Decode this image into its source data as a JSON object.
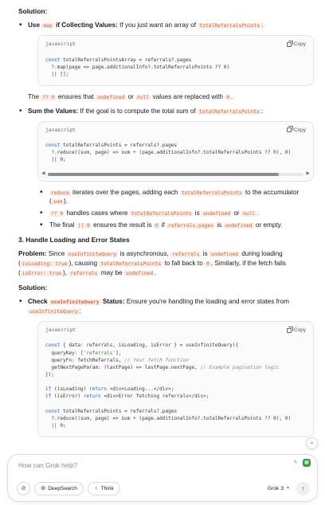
{
  "solution1": {
    "heading": "Solution:",
    "item1": {
      "lead": "Use",
      "map": "map",
      "lead2": "if Collecting Values:",
      "text": "If you just want an array of",
      "code": "totalReferralsPoints",
      "end": ":"
    },
    "code1": {
      "lang": "javascript",
      "copy": "Copy",
      "l1a": "const",
      "l1b": " totalReferralsPointsArray = referrals?.pages",
      "l2": "  ?.map(page => page.additionalInfo?.totalReferralsPoints ?? 0)",
      "l3": "  || [];"
    },
    "note": {
      "t1": "The",
      "c1": "?? 0",
      "t2": "ensures that",
      "c2": "undefined",
      "t3": "or",
      "c3": "null",
      "t4": "values are replaced with",
      "c4": "0",
      "t5": "."
    },
    "item2": {
      "lead": "Sum the Values:",
      "text": "If the goal is to compute the total sum of",
      "code": "totalReferralsPoints",
      "end": ":"
    },
    "code2": {
      "lang": "javascript",
      "copy": "Copy",
      "l1a": "const",
      "l1b": " totalReferralsPoints = referrals?.pages",
      "l2": "  ?.reduce((sum, page) => sum + (page.additionalInfo?.totalReferralsPoints ?? 0), 0)",
      "l3": "  || 0;"
    },
    "sub": [
      {
        "c1": "reduce",
        "t1": "iterates over the pages, adding each",
        "c2": "totalReferralsPoints",
        "t2": "to the accumulator",
        "c3": "sum",
        "t3": ").",
        "open": "("
      },
      {
        "c1": "?? 0",
        "t1": "handles cases where",
        "c2": "totalReferralsPoints",
        "t2": "is",
        "c3": "undefined",
        "t3": "or",
        "c4": "null",
        "t4": "."
      },
      {
        "t0": "The final",
        "c1": "|| 0",
        "t1": "ensures the result is",
        "c2": "0",
        "t2": "if",
        "c3": "referrals.pages",
        "t3": "is",
        "c4": "undefined",
        "t4": "or empty."
      }
    ]
  },
  "section3": {
    "title": "3. Handle Loading and Error States",
    "problem": {
      "lead": "Problem:",
      "t1": "Since",
      "c1": "useInfiniteQuery",
      "t2": "is asynchronous,",
      "c2": "referrals",
      "t3": "is",
      "c3": "undefined",
      "t4": "during loading",
      "open": "(",
      "c4": "isLoading: true",
      "t5": "), causing",
      "c5": "totalReferralsPoints",
      "t6": "to fall back to",
      "c6": "0",
      "t7": ". Similarly, if the fetch fails",
      "c7": "isError: true",
      "t8": "),",
      "c8": "referrals",
      "t9": "may be",
      "c9": "undefined",
      "t10": "."
    },
    "heading": "Solution:",
    "item": {
      "lead": "Check",
      "code": "useInfiniteQuery",
      "lead2": "Status:",
      "text": "Ensure you're handling the loading and error states from",
      "code2": "useInfiniteQuery",
      "end": ":"
    },
    "code3": {
      "lang": "javascript",
      "copy": "Copy",
      "l1a": "const",
      "l1b": " { data: referrals, isLoading, isError } = useInfiniteQuery({",
      "l2a": "  queryKey: [",
      "l2b": "'referrals'",
      "l2c": "],",
      "l3a": "  queryFn: fetchReferrals, ",
      "l3b": "// Your fetch function",
      "l4a": "  getNextPageParam: (lastPage) => lastPage.nextPage, ",
      "l4b": "// Example pagination logic",
      "l5": "});",
      "l6a": "if",
      "l6b": " (isLoading) ",
      "l6c": "return",
      "l6d": " <div>Loading...</div>;",
      "l7a": "if",
      "l7b": " (isError) ",
      "l7c": "return",
      "l7d": " <div>Error fetching referrals</div>;",
      "l8a": "const",
      "l8b": " totalReferralsPoints = referrals?.pages",
      "l9": "  ?.reduce((sum, page) => sum + (page.additionalInfo?.totalReferralsPoints ?? 0), 0)",
      "l10": "  || 0;"
    }
  },
  "composer": {
    "placeholder": "How can Grok help?",
    "deepsearch": "DeepSearch",
    "think": "Think",
    "model": "Grok 3"
  }
}
